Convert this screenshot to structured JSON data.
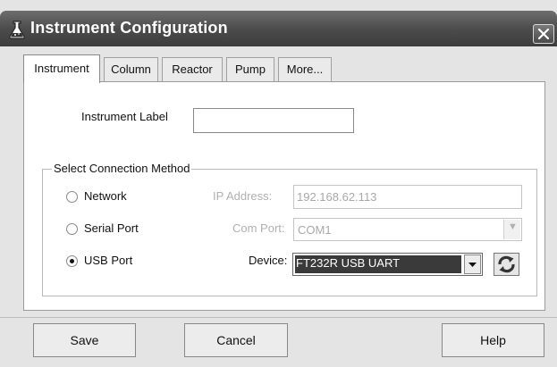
{
  "window": {
    "title": "Instrument Configuration"
  },
  "tabs": [
    {
      "label": "Instrument",
      "active": true
    },
    {
      "label": "Column",
      "active": false
    },
    {
      "label": "Reactor",
      "active": false
    },
    {
      "label": "Pump",
      "active": false
    },
    {
      "label": "More...",
      "active": false
    }
  ],
  "instrument": {
    "label_caption": "Instrument Label",
    "label_value": ""
  },
  "connection": {
    "group_title": "Select Connection Method",
    "methods": [
      {
        "label": "Network",
        "checked": false
      },
      {
        "label": "Serial Port",
        "checked": false
      },
      {
        "label": "USB Port",
        "checked": true
      }
    ],
    "ip_address": {
      "caption": "IP Address:",
      "value": "192.168.62.113",
      "enabled": false
    },
    "com_port": {
      "caption": "Com Port:",
      "value": "COM1",
      "enabled": false
    },
    "device": {
      "caption": "Device:",
      "value": "FT232R USB UART",
      "enabled": true
    }
  },
  "buttons": {
    "save": "Save",
    "cancel": "Cancel",
    "help": "Help"
  },
  "icons": {
    "app": "flask-icon",
    "close": "close-icon",
    "refresh": "refresh-icon",
    "dropdown": "chevron-down-icon"
  },
  "colors": {
    "titlebar": "#4c4c4c",
    "window_bg": "#e4e4e4",
    "panel_bg": "#ffffff",
    "selection": "#3a3a3a"
  }
}
